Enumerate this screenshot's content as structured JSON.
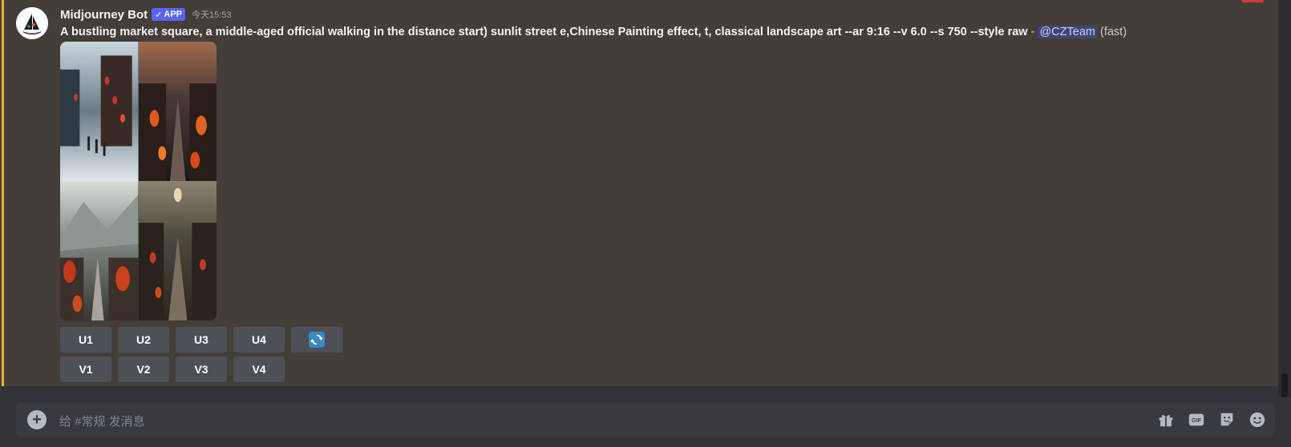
{
  "message": {
    "username": "Midjourney Bot",
    "badge": "APP",
    "badge_check": "✓",
    "timestamp": "今天15:53",
    "prompt_text": "A bustling market square, a middle-aged official walking in the distance start) sunlit street e,Chinese Painting effect, t, classical landscape art --ar 9:16 --v 6.0 --s 750 --style raw",
    "prompt_separator": " - ",
    "mention": "@CZTeam",
    "speed": "(fast)"
  },
  "buttons": {
    "upscale": [
      "U1",
      "U2",
      "U3",
      "U4"
    ],
    "variation": [
      "V1",
      "V2",
      "V3",
      "V4"
    ],
    "reroll_icon": "refresh-icon"
  },
  "input": {
    "placeholder": "给 #常规 发消息",
    "icons": [
      "gift-icon",
      "gif-icon",
      "sticker-icon",
      "emoji-icon"
    ],
    "gif_label": "GIF"
  },
  "colors": {
    "highlight_bar": "#f0b232",
    "badge": "#5865f2",
    "mention_bg": "#3f4673",
    "button_bg": "#4e5058",
    "refresh_blue": "#3b88c3"
  }
}
